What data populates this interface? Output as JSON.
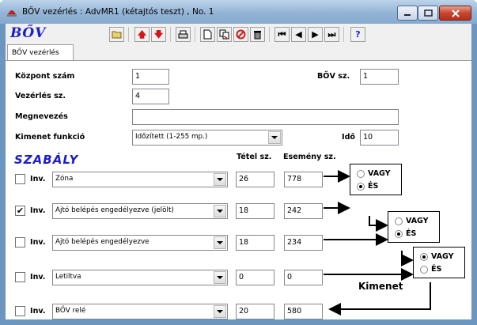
{
  "window": {
    "title": "BŐV vezérlés : AdvMR1 (kétajtós teszt) , No. 1"
  },
  "app_logo": "BŐV",
  "toolbar": {
    "icons": [
      "open-icon",
      "arrow-up-icon",
      "arrow-down-icon",
      "print-icon",
      "new-icon",
      "copy-icon",
      "delete-icon",
      "trash-icon",
      "first-icon",
      "prev-icon",
      "next-icon",
      "last-icon",
      "help-icon"
    ],
    "colors": {
      "red": "#d01818",
      "blue": "#1c1cd0",
      "navy": "#000080"
    }
  },
  "tab": {
    "label": "BŐV vezérlés"
  },
  "form": {
    "kozpont_label": "Központ szám",
    "kozpont_value": "1",
    "bov_label": "BŐV sz.",
    "bov_value": "1",
    "vezerles_label": "Vezérlés sz.",
    "vezerles_value": "4",
    "megnevezes_label": "Megnevezés",
    "megnevezes_value": "",
    "kimenet_label": "Kimenet funkció",
    "kimenet_value": "Időzített (1-255 mp.)",
    "ido_label": "Idő",
    "ido_value": "10"
  },
  "rules": {
    "title": "SZABÁLY",
    "col_tetel": "Tétel sz.",
    "col_esemeny": "Esemény sz.",
    "inv_label": "Inv.",
    "rows": [
      {
        "checked": false,
        "type": "Zóna",
        "tetel": "26",
        "esemeny": "778"
      },
      {
        "checked": true,
        "type": "Ajtó belépés engedélyezve (jelölt)",
        "tetel": "18",
        "esemeny": "242"
      },
      {
        "checked": false,
        "type": "Ajtó belépés engedélyezve",
        "tetel": "18",
        "esemeny": "234"
      },
      {
        "checked": false,
        "type": "Letiltva",
        "tetel": "0",
        "esemeny": "0"
      },
      {
        "checked": false,
        "type": "BŐV relé",
        "tetel": "20",
        "esemeny": "580"
      }
    ],
    "ops": [
      {
        "opt1": "VAGY",
        "opt2": "ÉS",
        "selected": "ÉS"
      },
      {
        "opt1": "VAGY",
        "opt2": "ÉS",
        "selected": "ÉS"
      },
      {
        "opt1": "VAGY",
        "opt2": "ÉS",
        "selected": "VAGY"
      }
    ],
    "output_label": "Kimenet"
  }
}
